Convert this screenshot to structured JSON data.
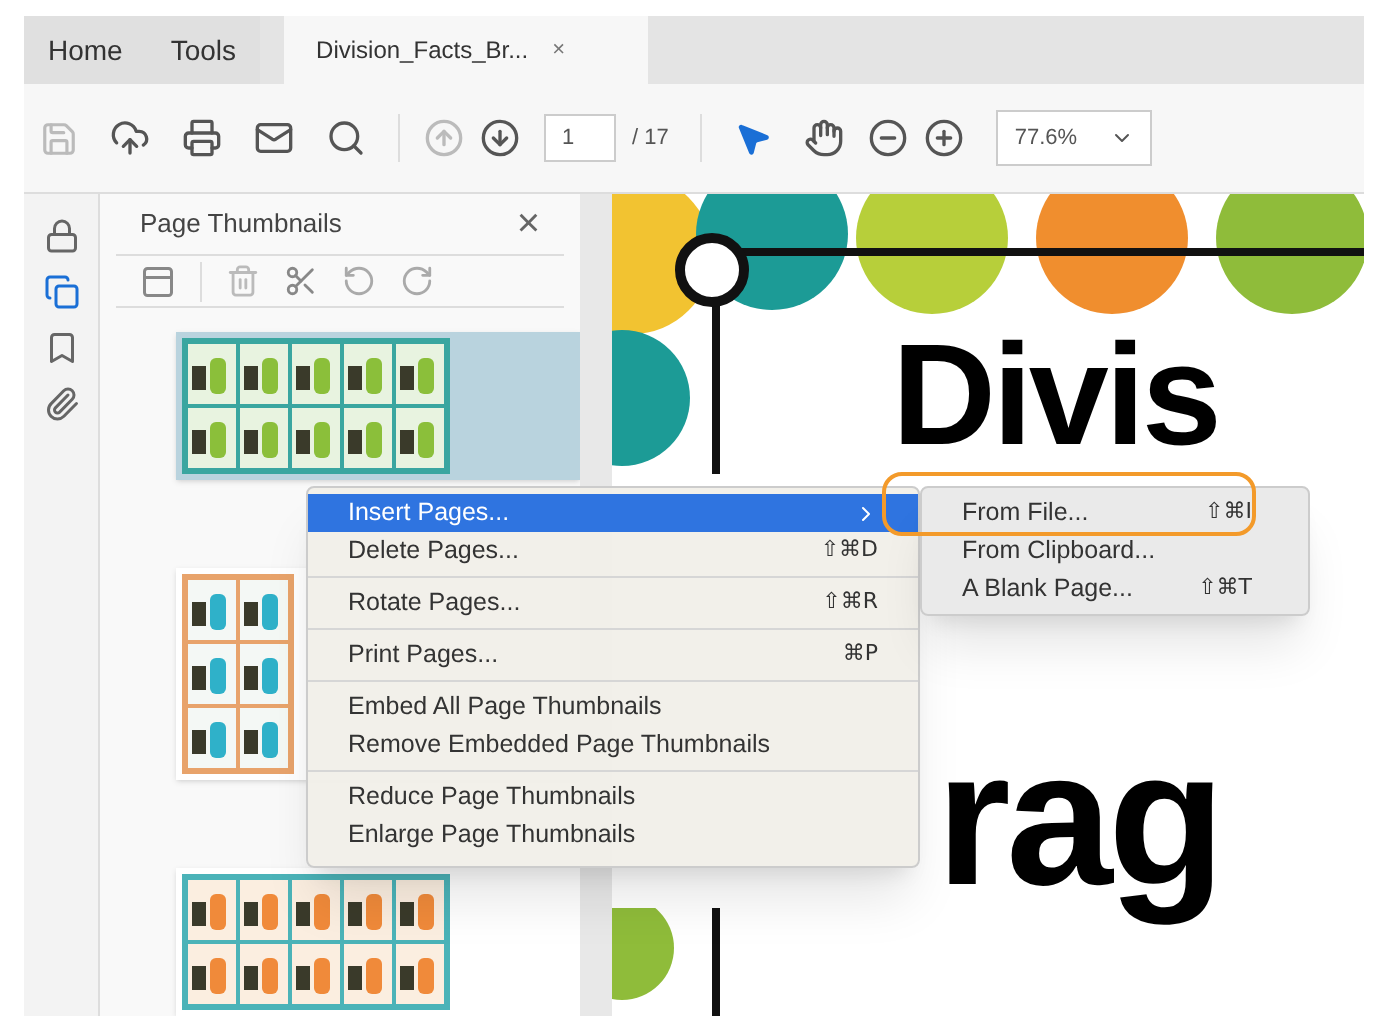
{
  "tabs": [
    {
      "label": "Home",
      "selected": false
    },
    {
      "label": "Tools",
      "selected": false
    },
    {
      "label": "Division_Facts_Br...",
      "selected": true,
      "close": "×"
    }
  ],
  "toolbar": {
    "page_number": "1",
    "page_total": "/ 17",
    "zoom": "77.6%"
  },
  "rail": [
    {
      "kind": "lock",
      "selected": false
    },
    {
      "kind": "pages",
      "selected": true
    },
    {
      "kind": "bookmark",
      "selected": false
    },
    {
      "kind": "attachment",
      "selected": false
    }
  ],
  "side_panel": {
    "title": "Page Thumbnails",
    "close": "×",
    "thumbnails": [
      {
        "kind": "picture",
        "selected": true
      },
      {
        "kind": "picture",
        "selected": false
      },
      {
        "kind": "picture",
        "selected": false
      }
    ]
  },
  "document": {
    "lines": [
      "Divis",
      "rag"
    ]
  },
  "context_menu": {
    "groups": [
      [
        {
          "label": "Insert Pages...",
          "selected": true,
          "has_submenu": true
        },
        {
          "label": "Delete Pages...",
          "shortcut": "⇧⌘D",
          "selected": false,
          "has_submenu": false
        }
      ],
      [
        {
          "label": "Rotate Pages...",
          "shortcut": "⇧⌘R",
          "selected": false,
          "has_submenu": false
        }
      ],
      [
        {
          "label": "Print Pages...",
          "shortcut": "⌘P",
          "selected": false,
          "has_submenu": false
        }
      ],
      [
        {
          "label": "Embed All Page Thumbnails",
          "selected": false,
          "has_submenu": false
        },
        {
          "label": "Remove Embedded Page Thumbnails",
          "selected": false,
          "has_submenu": false
        }
      ],
      [
        {
          "label": "Reduce Page Thumbnails",
          "selected": false,
          "has_submenu": false
        },
        {
          "label": "Enlarge Page Thumbnails",
          "selected": false,
          "has_submenu": false
        }
      ]
    ]
  },
  "submenu": {
    "items": [
      {
        "label": "From File...",
        "shortcut": "⇧⌘I",
        "circled": true
      },
      {
        "label": "From Clipboard...",
        "circled": false
      },
      {
        "label": "A Blank Page...",
        "shortcut": "⇧⌘T",
        "circled": false
      }
    ]
  }
}
